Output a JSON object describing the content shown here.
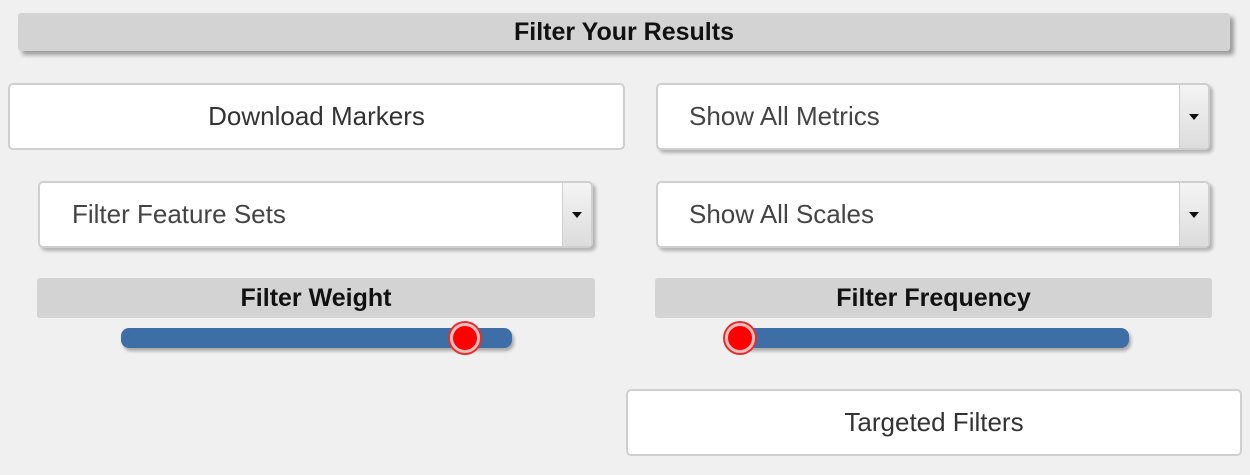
{
  "header": {
    "title": "Filter Your Results"
  },
  "buttons": {
    "download_markers": "Download Markers",
    "targeted_filters": "Targeted Filters"
  },
  "selects": {
    "metrics": {
      "selected": "Show All Metrics"
    },
    "feature_sets": {
      "selected": "Filter Feature Sets"
    },
    "scales": {
      "selected": "Show All Scales"
    }
  },
  "sliders": {
    "weight": {
      "label": "Filter Weight",
      "level": 0.88
    },
    "frequency": {
      "label": "Filter Frequency",
      "level": 0.04
    }
  },
  "colors": {
    "track": "#3d6ea5",
    "thumb": "#ff0000",
    "header_bg": "#d3d3d3"
  },
  "icons": {
    "dropdown_arrow": "chevron-down-icon"
  }
}
